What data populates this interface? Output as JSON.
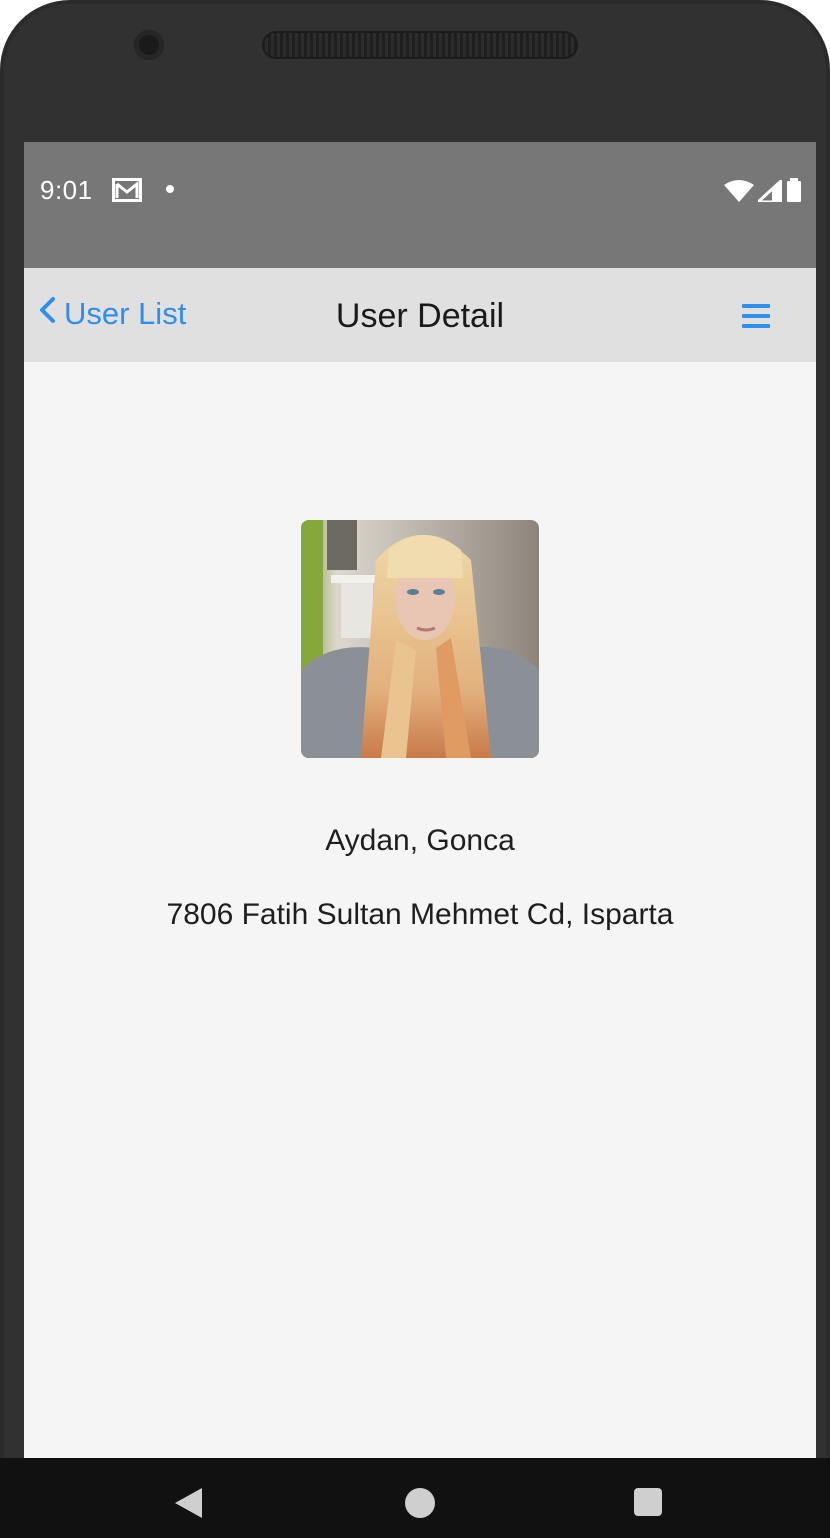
{
  "status_bar": {
    "time": "9:01",
    "icons": [
      "gmail-icon",
      "notification-dot-icon",
      "wifi-icon",
      "cell-signal-icon",
      "battery-icon"
    ]
  },
  "nav_bar": {
    "back_label": "User List",
    "title": "User Detail",
    "menu_icon": "hamburger-menu-icon",
    "accent_color": "#2f8ff0"
  },
  "user": {
    "name": "Aydan, Gonca",
    "address": "7806 Fatih Sultan Mehmet Cd, Isparta",
    "photo": "user-photo"
  },
  "system_nav": {
    "icons": [
      "back-triangle-icon",
      "home-circle-icon",
      "recents-square-icon"
    ]
  }
}
